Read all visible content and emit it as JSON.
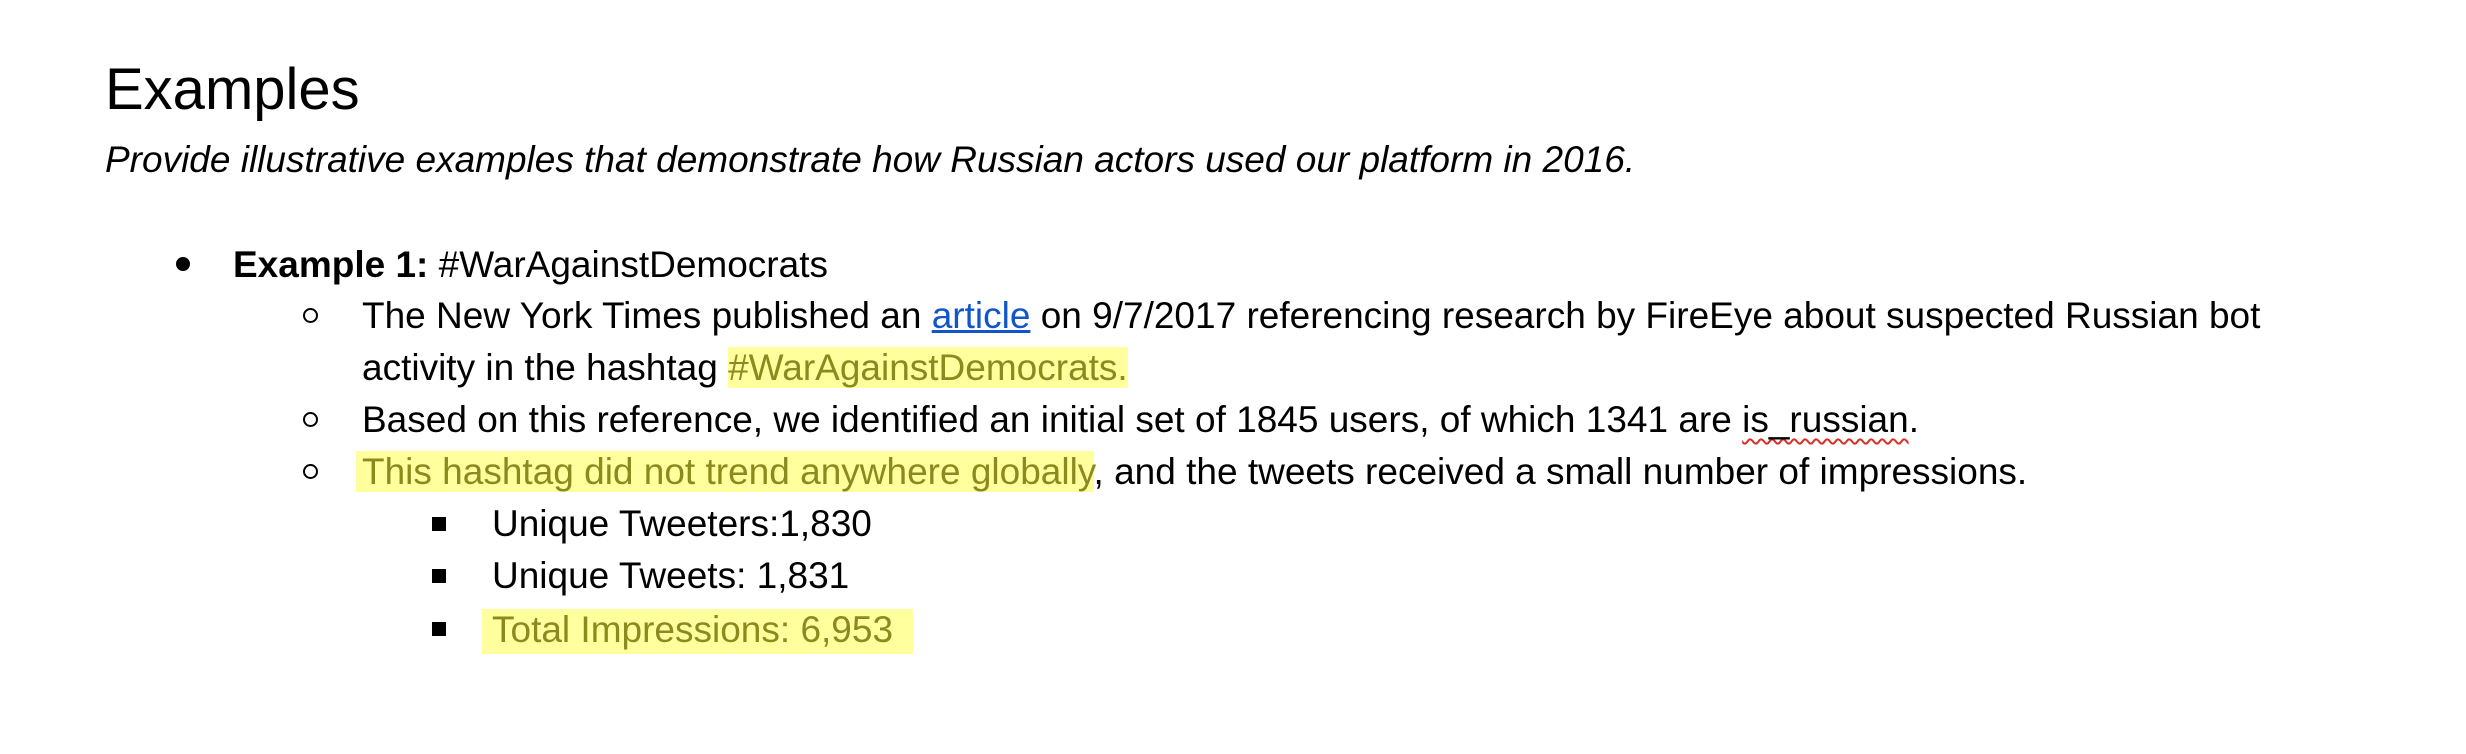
{
  "heading": "Examples",
  "subheading": "Provide illustrative examples that demonstrate how Russian actors used our platform in 2016.",
  "example1": {
    "label": "Example 1:",
    "hashtag": " #WarAgainstDemocrats",
    "items": {
      "item1": {
        "text_a": "The New York Times published an ",
        "link": "article",
        "text_b": " on 9/7/2017 referencing research by FireEye about suspected Russian bot",
        "text_c": "activity in the hashtag ",
        "highlight": "#WarAgainstDemocrats."
      },
      "item2": {
        "text_a": "Based on this reference, we identified an initial set of 1845 users, of which 1341 are ",
        "flagged": "is_russian",
        "text_b": "."
      },
      "item3": {
        "highlight": "This hashtag did not trend anywhere globally",
        "text": ", and the tweets received a small number of impressions."
      }
    },
    "stats": {
      "tweeters": "Unique Tweeters:1,830",
      "tweets": "Unique Tweets: 1,831",
      "impressions": "Total Impressions: 6,953 "
    }
  },
  "colors": {
    "highlight_bg": "#ffff9e",
    "highlight_text": "#8a8a1e",
    "link": "#1155cc",
    "spellcheck": "#d93025"
  }
}
